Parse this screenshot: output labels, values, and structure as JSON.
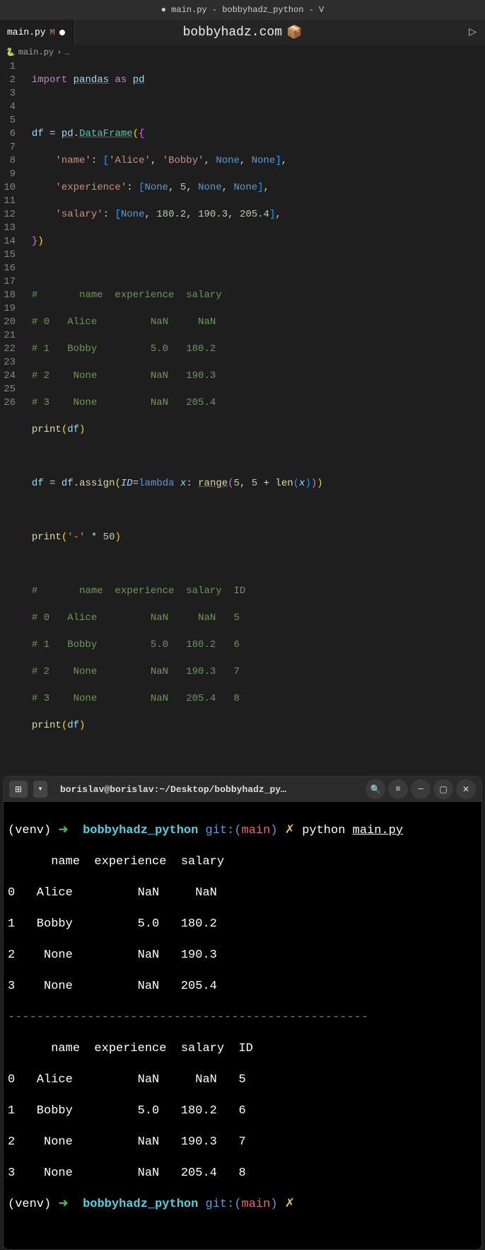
{
  "titlebar": "● main.py - bobbyhadz_python - V",
  "tab": {
    "name": "main.py",
    "modified_marker": "M"
  },
  "watermark": {
    "text": "bobbyhadz.com",
    "emoji": "📦"
  },
  "breadcrumb": {
    "file": "main.py",
    "sep": "›",
    "more": "…"
  },
  "gutter_lines": [
    "1",
    "2",
    "3",
    "4",
    "5",
    "6",
    "7",
    "8",
    "9",
    "10",
    "11",
    "12",
    "13",
    "14",
    "15",
    "16",
    "17",
    "18",
    "19",
    "20",
    "21",
    "22",
    "23",
    "24",
    "25",
    "26"
  ],
  "code": {
    "l1": {
      "import": "import",
      "pandas": "pandas",
      "as": "as",
      "pd": "pd"
    },
    "l3": {
      "df": "df",
      "eq": "=",
      "pd": "pd",
      "dot": ".",
      "DataFrame": "DataFrame"
    },
    "l4": {
      "key": "'name'",
      "alice": "'Alice'",
      "bobby": "'Bobby'",
      "none": "None"
    },
    "l5": {
      "key": "'experience'",
      "none": "None",
      "five": "5"
    },
    "l6": {
      "key": "'salary'",
      "none": "None",
      "v1": "180.2",
      "v2": "190.3",
      "v3": "205.4"
    },
    "l9": "#       name  experience  salary",
    "l10": "# 0   Alice         NaN     NaN",
    "l11": "# 1   Bobby         5.0   180.2",
    "l12": "# 2    None         NaN   190.3",
    "l13": "# 3    None         NaN   205.4",
    "l14": {
      "print": "print",
      "df": "df"
    },
    "l16": {
      "df": "df",
      "eq": "=",
      "assign": "assign",
      "ID": "ID",
      "lambda": "lambda",
      "x": "x",
      "range": "range",
      "five": "5",
      "plus": "+",
      "len": "len"
    },
    "l18": {
      "print": "print",
      "dash": "'-'",
      "star": "*",
      "fifty": "50"
    },
    "l20": "#       name  experience  salary  ID",
    "l21": "# 0   Alice         NaN     NaN   5",
    "l22": "# 1   Bobby         5.0   180.2   6",
    "l23": "# 2    None         NaN   190.3   7",
    "l24": "# 3    None         NaN   205.4   8",
    "l25": {
      "print": "print",
      "df": "df"
    }
  },
  "terminal": {
    "title": "borislav@borislav:~/Desktop/bobbyhadz_py…",
    "prompt": {
      "venv": "(venv)",
      "arrow": "➜",
      "dir": "bobbyhadz_python",
      "git": "git:(",
      "branch": "main",
      "gitclose": ")",
      "x": "✗",
      "cmd": "python",
      "file": "main.py"
    },
    "out1": [
      "      name  experience  salary",
      "0   Alice         NaN     NaN",
      "1   Bobby         5.0   180.2",
      "2    None         NaN   190.3",
      "3    None         NaN   205.4"
    ],
    "dash": "--------------------------------------------------",
    "out2": [
      "      name  experience  salary  ID",
      "0   Alice         NaN     NaN   5",
      "1   Bobby         5.0   180.2   6",
      "2    None         NaN   190.3   7",
      "3    None         NaN   205.4   8"
    ]
  }
}
